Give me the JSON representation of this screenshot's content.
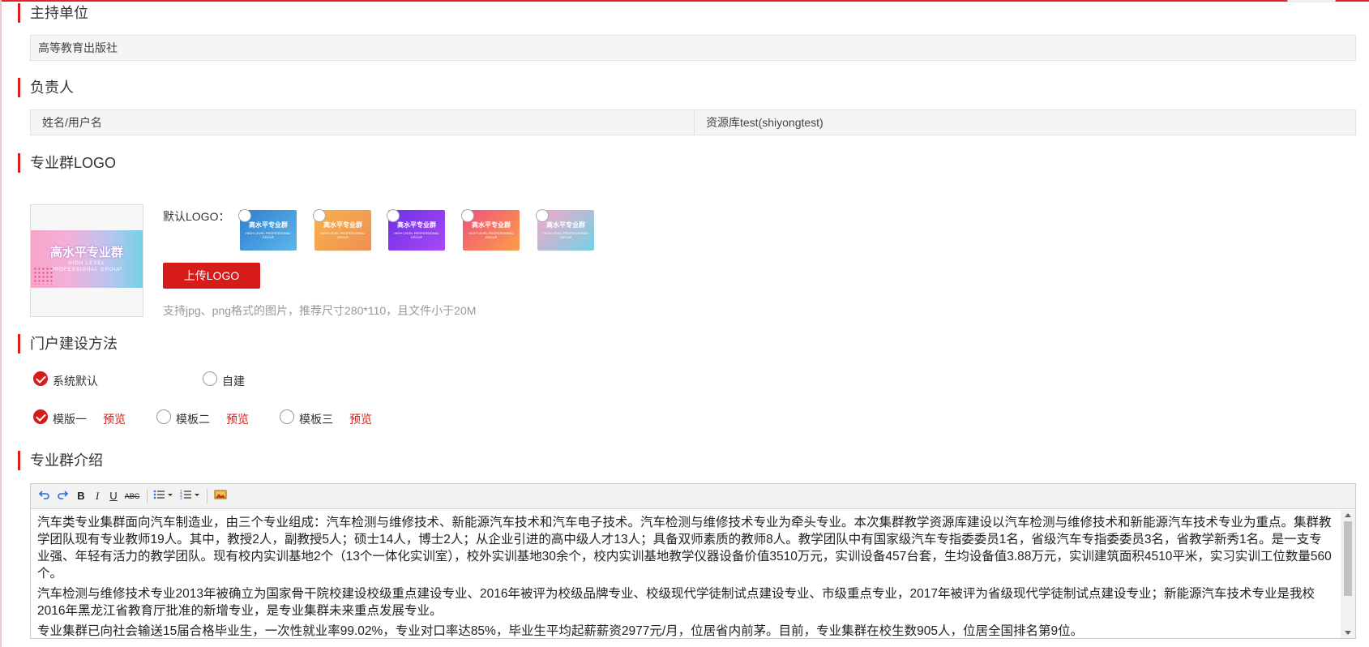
{
  "sections": {
    "host": {
      "title": "主持单位",
      "value": "高等教育出版社"
    },
    "leader": {
      "title": "负责人",
      "label": "姓名/用户名",
      "value": "资源库test(shiyongtest)"
    },
    "logo": {
      "title": "专业群LOGO",
      "preview_title": "高水平专业群",
      "preview_sub1": "HIGH LEVEL",
      "preview_sub2": "PROFESSIONAL GROUP",
      "default_label": "默认LOGO：",
      "thumbnails": [
        {
          "title": "高水平专业群",
          "sub": "HIGH LEVEL PROFESSIONAL GROUP",
          "color": "#3a8fd6"
        },
        {
          "title": "高水平专业群",
          "sub": "HIGH LEVEL PROFESSIONAL GROUP",
          "color": "#f3a24a"
        },
        {
          "title": "高水平专业群",
          "sub": "HIGH LEVEL PROFESSIONAL GROUP",
          "color": "#8a3cf0"
        },
        {
          "title": "高水平专业群",
          "sub": "HIGH LEVEL PROFESSIONAL GROUP",
          "color": "#f36a78"
        },
        {
          "title": "高水平专业群",
          "sub": "HIGH LEVEL PROFESSIONAL GROUP",
          "color": "#7fd0ea"
        }
      ],
      "upload_label": "上传LOGO",
      "hint": "支持jpg、png格式的图片，推荐尺寸280*110，且文件小于20M"
    },
    "portal": {
      "title": "门户建设方法",
      "methods": [
        {
          "label": "系统默认",
          "checked": true
        },
        {
          "label": "自建",
          "checked": false
        }
      ],
      "templates": [
        {
          "label": "模版一",
          "checked": true,
          "preview": "预览"
        },
        {
          "label": "模板二",
          "checked": false,
          "preview": "预览"
        },
        {
          "label": "模板三",
          "checked": false,
          "preview": "预览"
        }
      ]
    },
    "intro": {
      "title": "专业群介绍",
      "toolbar": [
        "undo-icon",
        "redo-icon",
        "B",
        "I",
        "U",
        "ABC",
        "unordered-list-icon",
        "ordered-list-icon",
        "image-icon"
      ],
      "paragraphs": [
        "汽车类专业集群面向汽车制造业，由三个专业组成：汽车检测与维修技术、新能源汽车技术和汽车电子技术。汽车检测与维修技术专业为牵头专业。本次集群教学资源库建设以汽车检测与维修技术和新能源汽车技术专业为重点。集群教学团队现有专业教师19人。其中，教授2人，副教授5人；硕士14人，博士2人；从企业引进的高中级人才13人；具备双师素质的教师8人。教学团队中有国家级汽车专指委委员1名，省级汽车专指委委员3名，省教学新秀1名。是一支专业强、年轻有活力的教学团队。现有校内实训基地2个（13个一体化实训室），校外实训基地30余个，校内实训基地教学仪器设备价值3510万元，实训设备457台套，生均设备值3.88万元，实训建筑面积4510平米，实习实训工位数量560个。",
        "汽车检测与维修技术专业2013年被确立为国家骨干院校建设校级重点建设专业、2016年被评为校级品牌专业、校级现代学徒制试点建设专业、市级重点专业，2017年被评为省级现代学徒制试点建设专业；新能源汽车技术专业是我校2016年黑龙江省教育厅批准的新增专业，是专业集群未来重点发展专业。",
        "专业集群已向社会输送15届合格毕业生，一次性就业率99.02%，专业对口率达85%，毕业生平均起薪薪资2977元/月，位居省内前茅。目前，专业集群在校生数905人，位居全国排名第9位。"
      ]
    }
  }
}
